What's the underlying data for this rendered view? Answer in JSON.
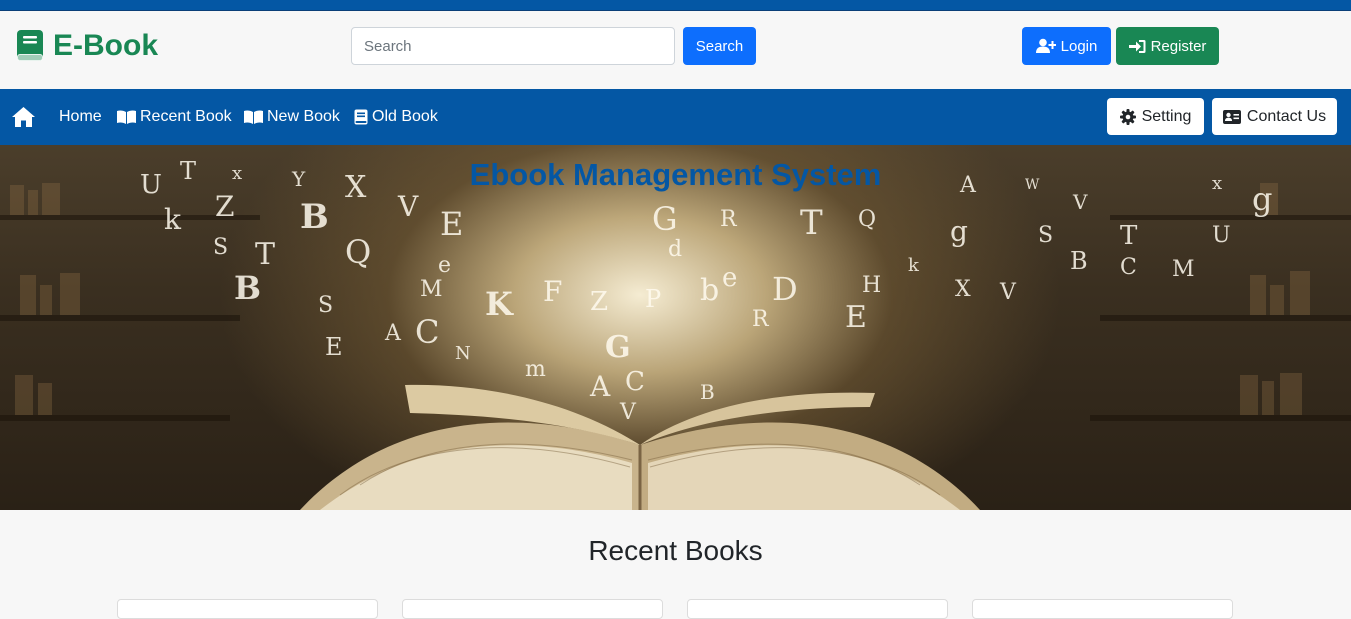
{
  "brand": {
    "name": "E-Book",
    "icon": "book-icon",
    "color": "#198754"
  },
  "search": {
    "placeholder": "Search",
    "button_label": "Search"
  },
  "auth": {
    "login_label": "Login",
    "register_label": "Register"
  },
  "nav": {
    "items": [
      {
        "label": "Home",
        "icon": "home-icon"
      },
      {
        "label": "Recent Book",
        "icon": "open-book-icon"
      },
      {
        "label": "New Book",
        "icon": "open-book-icon"
      },
      {
        "label": "Old Book",
        "icon": "book-icon"
      }
    ],
    "setting_label": "Setting",
    "contact_label": "Contact Us"
  },
  "hero": {
    "title": "Ebook Management System"
  },
  "recent": {
    "heading": "Recent Books"
  },
  "colors": {
    "primary": "#0d6efd",
    "success": "#198754",
    "navbar": "#0457a4"
  }
}
